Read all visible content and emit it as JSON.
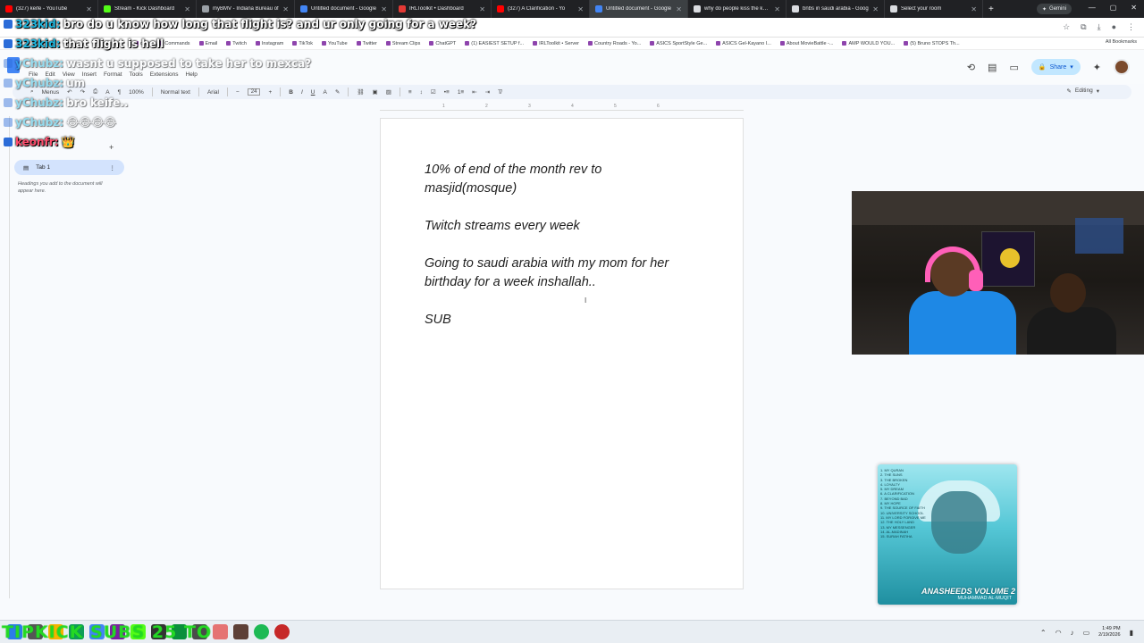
{
  "browser": {
    "tabs": [
      {
        "title": "(327) keife - YouTube",
        "color": "#ff0000"
      },
      {
        "title": "Stream - Kick Dashboard",
        "color": "#53fc18"
      },
      {
        "title": "myBMV - Indiana Bureau of",
        "color": "#9aa0a6"
      },
      {
        "title": "Untitled document - Google",
        "color": "#4285f4"
      },
      {
        "title": "IRLToolkit • Dashboard",
        "color": "#e53935"
      },
      {
        "title": "(327) A Clarification - Yo",
        "color": "#ff0000"
      },
      {
        "title": "Untitled document - Google",
        "color": "#4285f4",
        "active": true
      },
      {
        "title": "why do people kiss the kaab",
        "color": "#dadce0"
      },
      {
        "title": "bnbs in saudi arabia - Goog",
        "color": "#dadce0"
      },
      {
        "title": "Select your room",
        "color": "#dadce0"
      }
    ],
    "gemini_label": "Gemini",
    "bookmarks": [
      "chat",
      "Commands",
      "Email",
      "Twitch",
      "Instagram",
      "TikTok",
      "YouTube",
      "Twitter",
      "Stream Clips",
      "ChatGPT",
      "(1) EASIEST SETUP f...",
      "IRLToolkit • Server",
      "Country Roads - Yo...",
      "ASICS SportStyle Ge...",
      "ASICS Gel-Kayano I...",
      "About MovieBattle -...",
      "AMP WOULD YOU...",
      "(5) Bruno STOPS Th..."
    ],
    "all_bookmarks": "All Bookmarks"
  },
  "docs": {
    "menu": [
      "File",
      "Edit",
      "View",
      "Insert",
      "Format",
      "Tools",
      "Extensions",
      "Help"
    ],
    "share_label": "Share",
    "toolbar": {
      "menus": "Menus",
      "zoom": "100%",
      "style": "Normal text",
      "font": "Arial",
      "size": "24",
      "editing": "Editing"
    },
    "sidebar": {
      "tab_label": "Tab 1",
      "hint": "Headings you add to the document will appear here."
    },
    "ruler_marks": [
      "1",
      "2",
      "3",
      "4",
      "5",
      "6"
    ],
    "content": [
      "10% of end of the month rev to",
      "masjid(mosque)",
      "",
      "Twitch streams every week",
      "",
      "Going to saudi arabia with my mom for her",
      "birthday for a week inshallah..",
      "",
      "SUB"
    ]
  },
  "chat": [
    {
      "user": "323kid",
      "text": "bro do u know how long that flight is? and ur only going for a week?",
      "faded": false
    },
    {
      "user": "323kid",
      "text": "that flight is hell",
      "faded": false
    },
    {
      "user": "yChubz",
      "text": "wasnt u supposed to take her to mexca?",
      "faded": true
    },
    {
      "user": "yChubz",
      "text": "um",
      "faded": true
    },
    {
      "user": "yChubz",
      "text": "bro keife..",
      "faded": true
    },
    {
      "user": "yChubz",
      "text": "😂😂😂😂",
      "faded": true
    },
    {
      "user": "keonfr",
      "text": "👑",
      "faded": false
    }
  ],
  "album": {
    "tracks": [
      "1. MY QURAN",
      "2. THE SUNS",
      "3. THE BROKEN",
      "4. LOYALTY",
      "5. MY DREAM",
      "6. A CLARIFICATION",
      "7. BEYOND BAD",
      "8. MY HOPE",
      "9. THE SOURCE OF FAITH",
      "10. UNIVERSITY SCHOOL",
      "11. MY LORD FORGIVE ME",
      "12. THE HOLY LAND",
      "13. MY MESSENGER",
      "14. AL-MADINAH",
      "15. SURAH FATIHA"
    ],
    "title": "ANASHEEDS VOLUME 2",
    "artist": "MUHAMMAD AL-MUQIT"
  },
  "overlay": {
    "text": "TIPKICK SUBS 25 TO"
  },
  "taskbar": {
    "time": "1:49 PM",
    "date": "2/19/2026"
  }
}
